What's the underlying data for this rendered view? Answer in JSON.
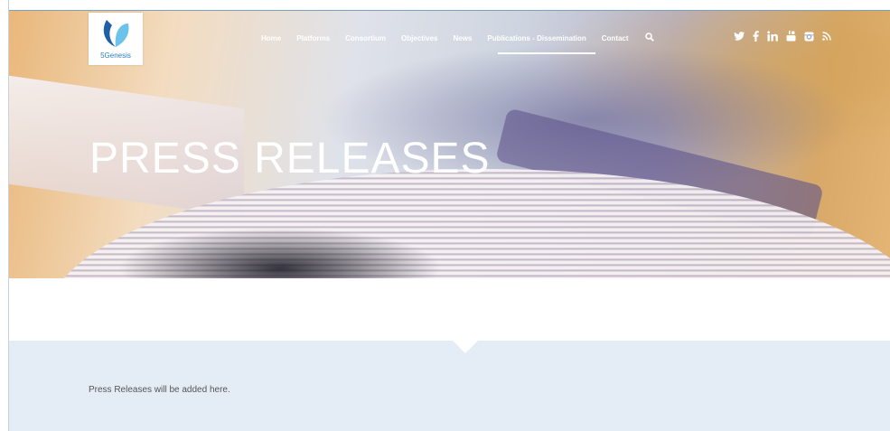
{
  "brand": {
    "logo_text": "5Genesis",
    "accent": "#2a7fc0"
  },
  "nav": {
    "items": [
      {
        "label": "Home"
      },
      {
        "label": "Platforms"
      },
      {
        "label": "Consortium"
      },
      {
        "label": "Objectives"
      },
      {
        "label": "News"
      },
      {
        "label": "Publications - Dissemination",
        "active": true
      },
      {
        "label": "Contact"
      }
    ]
  },
  "social": [
    "twitter-icon",
    "facebook-icon",
    "linkedin-icon",
    "youtube-icon",
    "instagram-icon",
    "rss-icon"
  ],
  "hero": {
    "title": "PRESS RELEASES"
  },
  "content": {
    "text": "Press Releases will be added here."
  },
  "colors": {
    "content_band": "#e4edf5",
    "nav_text": "#ffffff",
    "body_text": "#555555"
  }
}
